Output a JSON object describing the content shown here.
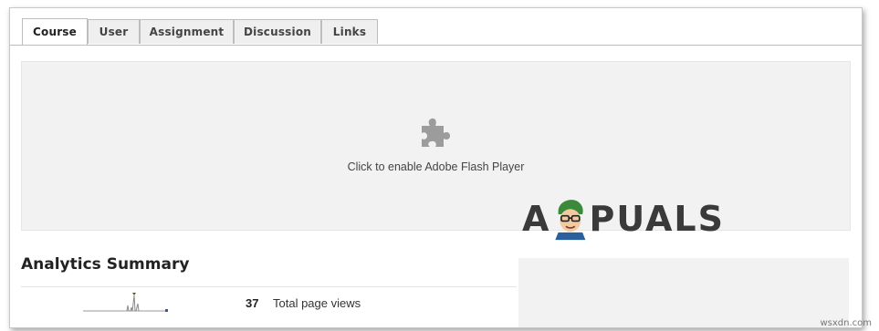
{
  "tabs": [
    {
      "label": "Course",
      "active": true
    },
    {
      "label": "User",
      "active": false
    },
    {
      "label": "Assignment",
      "active": false
    },
    {
      "label": "Discussion",
      "active": false
    },
    {
      "label": "Links",
      "active": false
    }
  ],
  "flash": {
    "icon": "puzzle-piece-icon",
    "message": "Click to enable Adobe Flash Player"
  },
  "analytics": {
    "title": "Analytics Summary",
    "stats": [
      {
        "value": "37",
        "label": "Total page views"
      }
    ]
  },
  "watermark": {
    "text_left": "A",
    "text_right": "PUALS",
    "site": "wsxdn.com"
  },
  "colors": {
    "tab_bg": "#efefef",
    "tab_active_bg": "#ffffff",
    "panel_bg": "#f2f2f2",
    "sparkline": "#8a8a8a",
    "sparkline_marker": "#2a5bb5",
    "watermark_accent": "#3b8a3b"
  }
}
